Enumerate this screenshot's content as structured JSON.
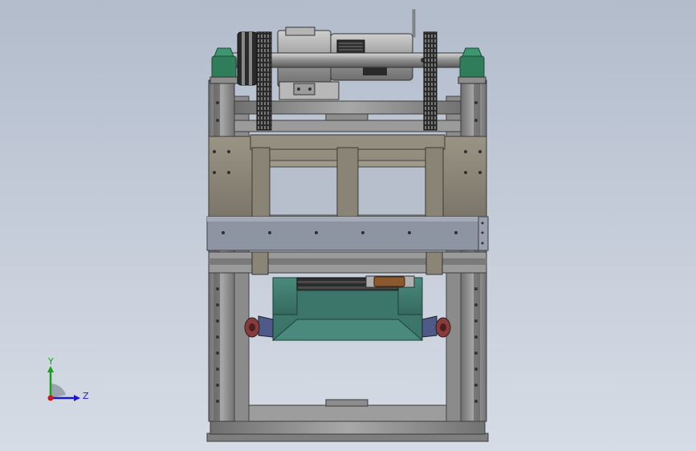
{
  "viewport": {
    "background_top": "#b2bccb",
    "background_bottom": "#d6dce5"
  },
  "model": {
    "description_icon": "cad-assembly",
    "colors": {
      "frame": "#8e8e8e",
      "frame_dark": "#5d5d5d",
      "plate": "#8b8578",
      "plate_dark": "#6b665b",
      "motor_body": "#a9a9a9",
      "motor_dark": "#3a3a3a",
      "bearing_green": "#2f7d5a",
      "teal_block": "#3f7a6e",
      "bronze": "#8a5a2e",
      "wheel_red": "#8a3a3a",
      "wheel_blue": "#4e5a8a"
    }
  },
  "triad": {
    "y_label": "Y",
    "z_label": "Z",
    "y_color": "#19a019",
    "z_color": "#1a1acc",
    "x_color": "#cc1a1a"
  }
}
